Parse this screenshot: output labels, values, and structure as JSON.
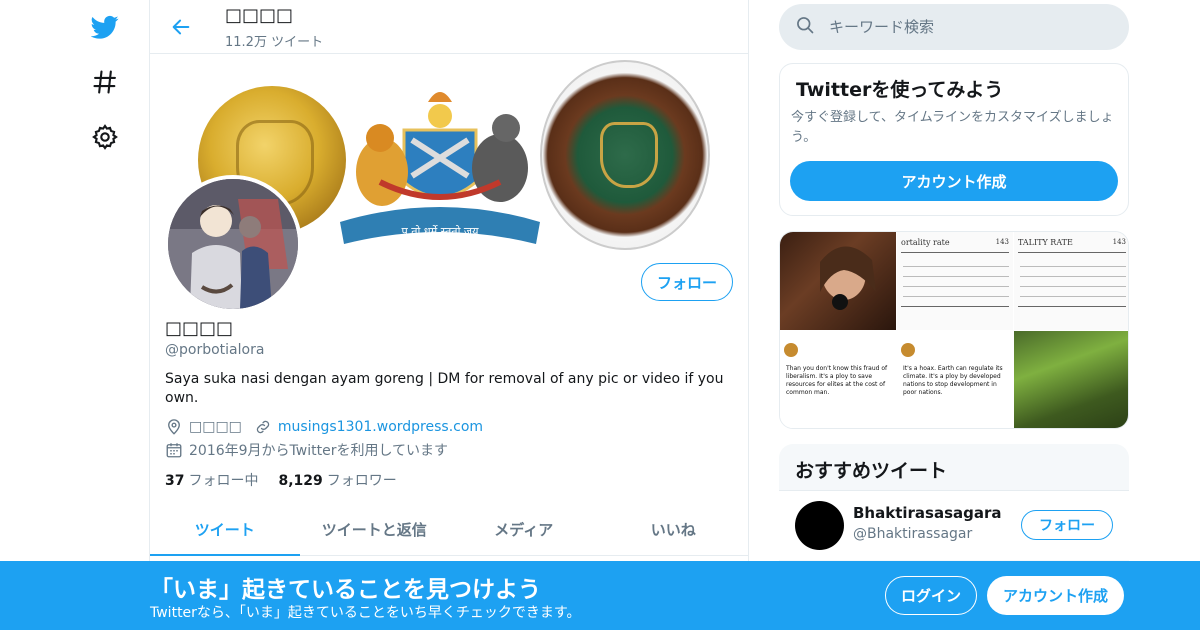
{
  "colors": {
    "accent": "#1da1f2",
    "text": "#14171a",
    "muted": "#657786",
    "border": "#e6ecf0"
  },
  "nav": {
    "logo_icon": "twitter-bird-icon",
    "explore_icon": "hashtag-icon",
    "settings_icon": "gear-icon"
  },
  "header": {
    "name": "□□□□",
    "tweet_count": "11.2万 ツイート",
    "back_icon": "arrow-left-icon"
  },
  "profile": {
    "display_name": "□□□□",
    "handle": "@porbotialora",
    "bio": "Saya suka nasi dengan ayam goreng | DM for removal of any pic or video if you own.",
    "location": "□□□□",
    "website": "musings1301.wordpress.com",
    "joined": "2016年9月からTwitterを利用しています",
    "follow_label": "フォロー",
    "following_count": "37",
    "following_label": "フォロー中",
    "followers_count": "8,129",
    "followers_label": "フォロワー"
  },
  "banner_text": "प ताे धर्मे स्ततो जय",
  "tabs": [
    {
      "label": "ツイート"
    },
    {
      "label": "ツイートと返信"
    },
    {
      "label": "メディア"
    },
    {
      "label": "いいね"
    }
  ],
  "search": {
    "placeholder": "キーワード検索"
  },
  "signup_card": {
    "title": "Twitterを使ってみよう",
    "description": "今すぐ登録して、タイムラインをカスタマイズしましょう。",
    "button": "アカウント作成"
  },
  "media": {
    "rate_title": "ortality rate",
    "rate_page": "143",
    "rate_title_2": "TALITY RATE",
    "rate_page_2": "143",
    "tweet1_text": "Than you don't know this fraud of liberalism. It's a ploy to save resources for elites at the cost of common man.",
    "tweet2_text": "It's a hoax. Earth can regulate its climate. It's a ploy by developed nations to stop development in poor nations."
  },
  "recommended": {
    "title": "おすすめツイート",
    "name": "Bhaktirasasagara",
    "handle": "@Bhaktirassagar",
    "follow_label": "フォロー"
  },
  "bottom_bar": {
    "title": "「いま」起きていることを見つけよう",
    "subtitle": "Twitterなら、「いま」起きていることをいち早くチェックできます。",
    "login": "ログイン",
    "signup": "アカウント作成"
  }
}
